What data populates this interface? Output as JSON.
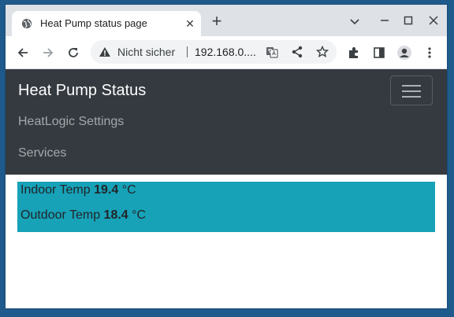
{
  "browser": {
    "tab_title": "Heat Pump status page",
    "omnibox": {
      "security_label": "Nicht sicher",
      "url": "192.168.0...."
    }
  },
  "navbar": {
    "brand": "Heat Pump Status",
    "links": [
      "HeatLogic Settings",
      "Services"
    ]
  },
  "readings": [
    {
      "label": "Indoor Temp",
      "value": "19.4",
      "unit": "°C"
    },
    {
      "label": "Outdoor Temp",
      "value": "18.4",
      "unit": "°C"
    }
  ],
  "colors": {
    "navbar_bg": "#343a40",
    "info_bg": "#17a2b8"
  }
}
